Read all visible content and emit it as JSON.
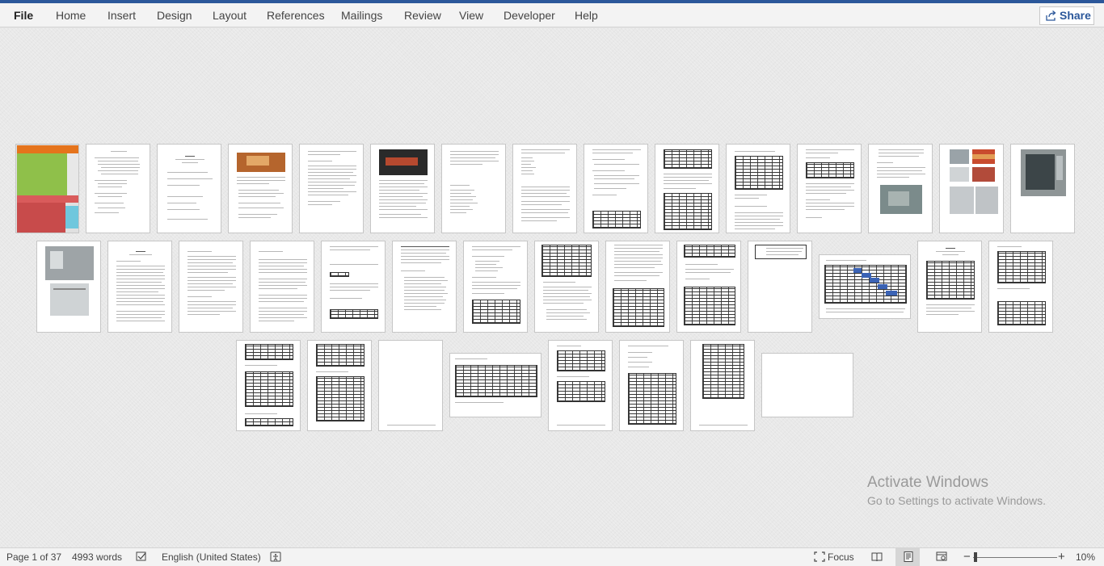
{
  "ribbon": {
    "tabs": [
      "File",
      "Home",
      "Insert",
      "Design",
      "Layout",
      "References",
      "Mailings",
      "Review",
      "View",
      "Developer",
      "Help"
    ],
    "share_label": "Share",
    "accent_color": "#2b579a"
  },
  "document": {
    "page_count": 37,
    "rows": [
      15,
      14,
      8
    ]
  },
  "watermark": {
    "line1": "Activate Windows",
    "line2": "Go to Settings to activate Windows."
  },
  "status": {
    "page": "Page 1 of 37",
    "words": "4993 words",
    "language": "English (United States)",
    "focus": "Focus",
    "zoom": "10%",
    "zoom_minus": "−",
    "zoom_plus": "+"
  },
  "icons": {
    "share": "share-icon",
    "proofing": "proofing-icon",
    "accessibility": "accessibility-icon",
    "focus": "focus-icon",
    "read_mode": "read-mode-icon",
    "print_layout": "print-layout-icon",
    "web_layout": "web-layout-icon"
  }
}
